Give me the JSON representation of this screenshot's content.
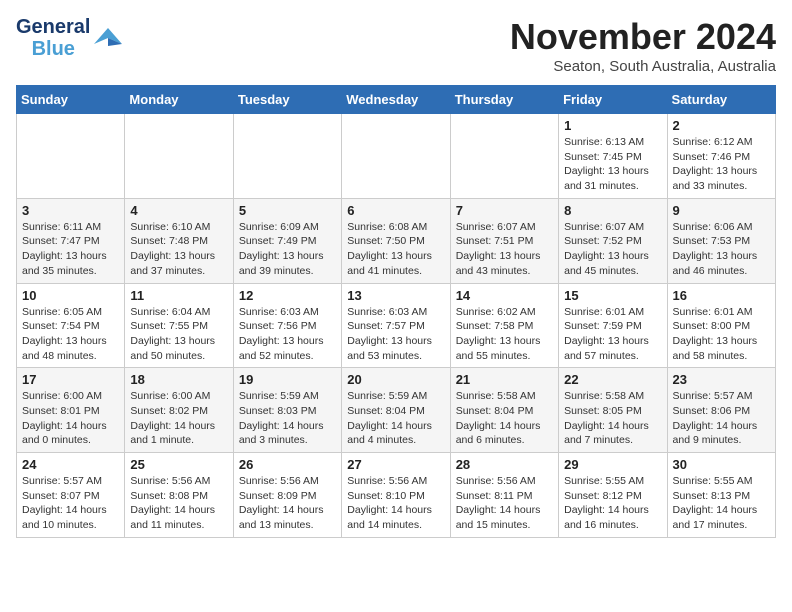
{
  "header": {
    "logo_general": "General",
    "logo_blue": "Blue",
    "month_title": "November 2024",
    "subtitle": "Seaton, South Australia, Australia"
  },
  "columns": [
    "Sunday",
    "Monday",
    "Tuesday",
    "Wednesday",
    "Thursday",
    "Friday",
    "Saturday"
  ],
  "weeks": [
    [
      {
        "day": "",
        "info": ""
      },
      {
        "day": "",
        "info": ""
      },
      {
        "day": "",
        "info": ""
      },
      {
        "day": "",
        "info": ""
      },
      {
        "day": "",
        "info": ""
      },
      {
        "day": "1",
        "info": "Sunrise: 6:13 AM\nSunset: 7:45 PM\nDaylight: 13 hours\nand 31 minutes."
      },
      {
        "day": "2",
        "info": "Sunrise: 6:12 AM\nSunset: 7:46 PM\nDaylight: 13 hours\nand 33 minutes."
      }
    ],
    [
      {
        "day": "3",
        "info": "Sunrise: 6:11 AM\nSunset: 7:47 PM\nDaylight: 13 hours\nand 35 minutes."
      },
      {
        "day": "4",
        "info": "Sunrise: 6:10 AM\nSunset: 7:48 PM\nDaylight: 13 hours\nand 37 minutes."
      },
      {
        "day": "5",
        "info": "Sunrise: 6:09 AM\nSunset: 7:49 PM\nDaylight: 13 hours\nand 39 minutes."
      },
      {
        "day": "6",
        "info": "Sunrise: 6:08 AM\nSunset: 7:50 PM\nDaylight: 13 hours\nand 41 minutes."
      },
      {
        "day": "7",
        "info": "Sunrise: 6:07 AM\nSunset: 7:51 PM\nDaylight: 13 hours\nand 43 minutes."
      },
      {
        "day": "8",
        "info": "Sunrise: 6:07 AM\nSunset: 7:52 PM\nDaylight: 13 hours\nand 45 minutes."
      },
      {
        "day": "9",
        "info": "Sunrise: 6:06 AM\nSunset: 7:53 PM\nDaylight: 13 hours\nand 46 minutes."
      }
    ],
    [
      {
        "day": "10",
        "info": "Sunrise: 6:05 AM\nSunset: 7:54 PM\nDaylight: 13 hours\nand 48 minutes."
      },
      {
        "day": "11",
        "info": "Sunrise: 6:04 AM\nSunset: 7:55 PM\nDaylight: 13 hours\nand 50 minutes."
      },
      {
        "day": "12",
        "info": "Sunrise: 6:03 AM\nSunset: 7:56 PM\nDaylight: 13 hours\nand 52 minutes."
      },
      {
        "day": "13",
        "info": "Sunrise: 6:03 AM\nSunset: 7:57 PM\nDaylight: 13 hours\nand 53 minutes."
      },
      {
        "day": "14",
        "info": "Sunrise: 6:02 AM\nSunset: 7:58 PM\nDaylight: 13 hours\nand 55 minutes."
      },
      {
        "day": "15",
        "info": "Sunrise: 6:01 AM\nSunset: 7:59 PM\nDaylight: 13 hours\nand 57 minutes."
      },
      {
        "day": "16",
        "info": "Sunrise: 6:01 AM\nSunset: 8:00 PM\nDaylight: 13 hours\nand 58 minutes."
      }
    ],
    [
      {
        "day": "17",
        "info": "Sunrise: 6:00 AM\nSunset: 8:01 PM\nDaylight: 14 hours\nand 0 minutes."
      },
      {
        "day": "18",
        "info": "Sunrise: 6:00 AM\nSunset: 8:02 PM\nDaylight: 14 hours\nand 1 minute."
      },
      {
        "day": "19",
        "info": "Sunrise: 5:59 AM\nSunset: 8:03 PM\nDaylight: 14 hours\nand 3 minutes."
      },
      {
        "day": "20",
        "info": "Sunrise: 5:59 AM\nSunset: 8:04 PM\nDaylight: 14 hours\nand 4 minutes."
      },
      {
        "day": "21",
        "info": "Sunrise: 5:58 AM\nSunset: 8:04 PM\nDaylight: 14 hours\nand 6 minutes."
      },
      {
        "day": "22",
        "info": "Sunrise: 5:58 AM\nSunset: 8:05 PM\nDaylight: 14 hours\nand 7 minutes."
      },
      {
        "day": "23",
        "info": "Sunrise: 5:57 AM\nSunset: 8:06 PM\nDaylight: 14 hours\nand 9 minutes."
      }
    ],
    [
      {
        "day": "24",
        "info": "Sunrise: 5:57 AM\nSunset: 8:07 PM\nDaylight: 14 hours\nand 10 minutes."
      },
      {
        "day": "25",
        "info": "Sunrise: 5:56 AM\nSunset: 8:08 PM\nDaylight: 14 hours\nand 11 minutes."
      },
      {
        "day": "26",
        "info": "Sunrise: 5:56 AM\nSunset: 8:09 PM\nDaylight: 14 hours\nand 13 minutes."
      },
      {
        "day": "27",
        "info": "Sunrise: 5:56 AM\nSunset: 8:10 PM\nDaylight: 14 hours\nand 14 minutes."
      },
      {
        "day": "28",
        "info": "Sunrise: 5:56 AM\nSunset: 8:11 PM\nDaylight: 14 hours\nand 15 minutes."
      },
      {
        "day": "29",
        "info": "Sunrise: 5:55 AM\nSunset: 8:12 PM\nDaylight: 14 hours\nand 16 minutes."
      },
      {
        "day": "30",
        "info": "Sunrise: 5:55 AM\nSunset: 8:13 PM\nDaylight: 14 hours\nand 17 minutes."
      }
    ]
  ]
}
